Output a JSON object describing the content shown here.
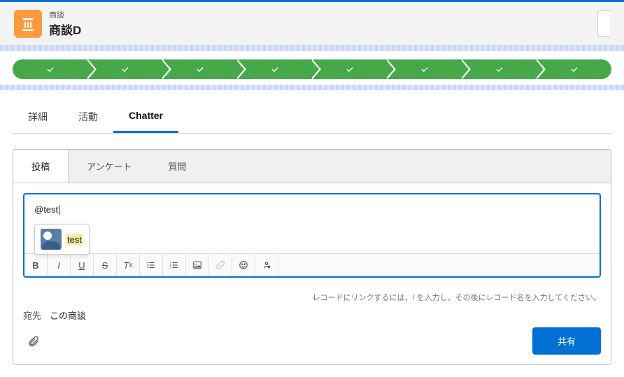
{
  "header": {
    "type": "商談",
    "title": "商談D"
  },
  "tabs": {
    "detail": "詳細",
    "activity": "活動",
    "chatter": "Chatter"
  },
  "subtabs": {
    "post": "投稿",
    "poll": "アンケート",
    "question": "質問"
  },
  "editor": {
    "content": "@test",
    "mention_suggestion": "test"
  },
  "hint": "レコードにリンクするには、/ を入力し、その後にレコード名を入力してください。",
  "footer": {
    "to_label": "宛先",
    "to_value": "この商談",
    "share": "共有"
  }
}
